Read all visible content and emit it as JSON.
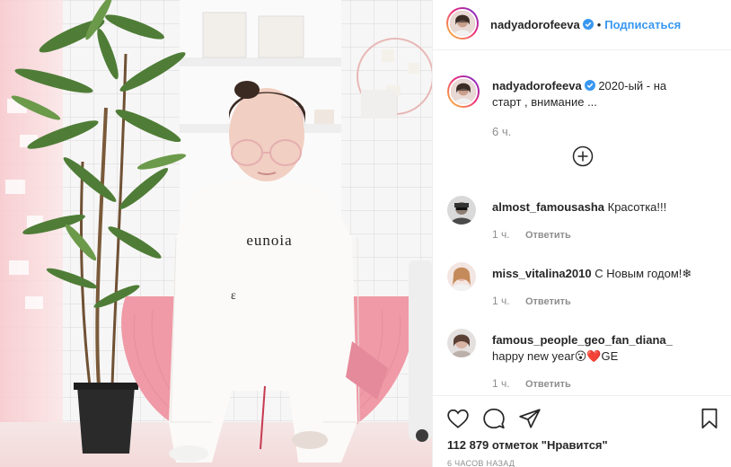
{
  "photo": {
    "shirt_text": "eunoia",
    "shirt_small_text": "ε"
  },
  "header": {
    "username": "nadyadorofeeva",
    "dot": "•",
    "follow_label": "Подписаться"
  },
  "caption": {
    "username": "nadyadorofeeva",
    "text": "2020-ый - на старт , внимание ...",
    "time": "6 ч."
  },
  "comments": [
    {
      "username": "almost_famousasha",
      "text": "Красотка!!!",
      "time": "1 ч.",
      "reply_label": "Ответить"
    },
    {
      "username": "miss_vitalina2010",
      "text": "С Новым годом!❄",
      "time": "1 ч.",
      "reply_label": "Ответить"
    },
    {
      "username": "famous_people_geo_fan_diana_",
      "text": "happy new year😮❤️GE",
      "time": "1 ч.",
      "reply_label": "Ответить"
    }
  ],
  "actions": {
    "likes": "112 879 отметок \"Нравится\"",
    "posted": "6 ЧАСОВ НАЗАД"
  },
  "icons": {
    "verified": "verified-badge-icon",
    "load_more": "plus-circle-icon",
    "like": "heart-icon",
    "comment": "speech-bubble-icon",
    "share": "paper-plane-icon",
    "save": "bookmark-icon"
  },
  "colors": {
    "link_blue": "#3897f0",
    "verified_blue": "#3897f0",
    "muted": "#8e8e8e",
    "pants_pink": "#ef9aa6"
  }
}
